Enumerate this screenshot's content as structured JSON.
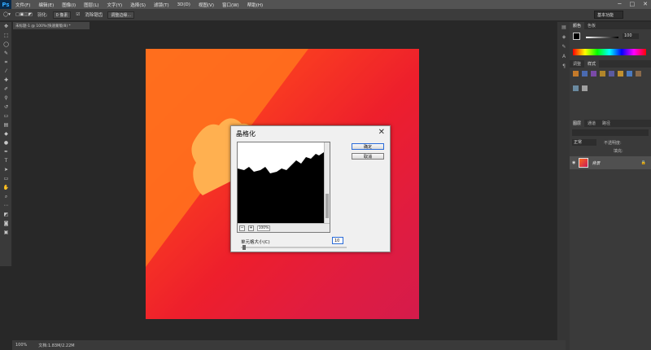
{
  "app": {
    "logo": "Ps"
  },
  "menu": [
    "文件(F)",
    "编辑(E)",
    "图像(I)",
    "图层(L)",
    "文字(Y)",
    "选择(S)",
    "滤镜(T)",
    "3D(D)",
    "视图(V)",
    "窗口(W)",
    "帮助(H)"
  ],
  "window_controls": [
    "─",
    "□",
    "✕"
  ],
  "options": {
    "feather_label": "羽化:",
    "feather_value": "0 像素",
    "antialias_label": "消除锯齿",
    "refine_label": "调整边缘...",
    "workspace": "基本功能"
  },
  "doc_tab": "未标题-1 @ 100%(快速蒙版/8) *",
  "layers_tabs": [
    "图层",
    "通道",
    "路径"
  ],
  "color_tabs": [
    "颜色",
    "色板"
  ],
  "adjust_tabs": [
    "调整",
    "样式"
  ],
  "opacity_value": "100",
  "layers_blend": "正常",
  "layers_opacity_label": "不透明度:",
  "layers_fill_label": "填充:",
  "layer_name": "背景",
  "status": {
    "zoom": "100%",
    "doc": "文档:1.83M/2.22M"
  },
  "dialog": {
    "title": "晶格化",
    "ok": "确定",
    "cancel": "取消",
    "preview_zoom": "100%",
    "cell_size_label": "单元格大小(C)",
    "cell_size_value": "10"
  },
  "colors": {
    "canvas_top": "#ff6a1a",
    "canvas_bottom": "#c81a5a",
    "accent_blue": "#2a6bd8"
  }
}
